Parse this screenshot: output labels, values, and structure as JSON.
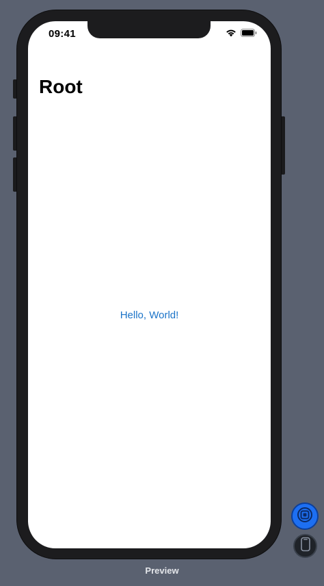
{
  "status_bar": {
    "time": "09:41"
  },
  "navigation": {
    "title": "Root"
  },
  "content": {
    "link_text": "Hello, World!"
  },
  "footer": {
    "label": "Preview"
  },
  "icons": {
    "wifi": "wifi-icon",
    "battery": "battery-icon",
    "live_preview": "live-preview-icon",
    "device": "device-icon"
  },
  "colors": {
    "background": "#5a6170",
    "link": "#1a73c8",
    "live_preview_button": "#1d6ff2"
  }
}
